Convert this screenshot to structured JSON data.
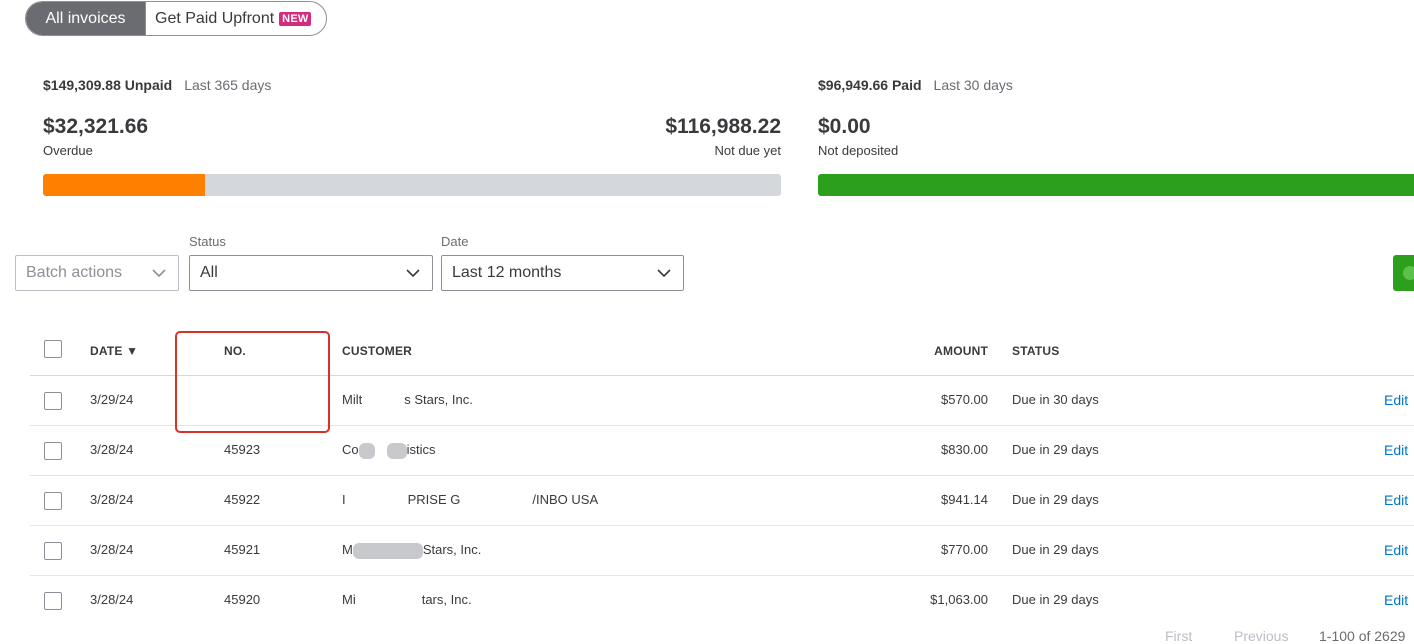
{
  "tabs": {
    "active": "All invoices",
    "inactive": "Get Paid Upfront",
    "badge": "NEW"
  },
  "summary": {
    "unpaid_amount": "$149,309.88 Unpaid",
    "unpaid_period": "Last 365 days",
    "overdue_value": "$32,321.66",
    "overdue_label": "Overdue",
    "notdue_value": "$116,988.22",
    "notdue_label": "Not due yet",
    "overdue_fraction": 0.22,
    "paid_amount": "$96,949.66 Paid",
    "paid_period": "Last 30 days",
    "notdeposited_value": "$0.00",
    "notdeposited_label": "Not deposited",
    "colors": {
      "overdue": "#ff8000",
      "paid": "#2ca01c",
      "track": "#d4d7dc"
    }
  },
  "filters": {
    "batch_label": "Batch actions",
    "status_label": "Status",
    "status_value": "All",
    "date_label": "Date",
    "date_value": "Last 12 months"
  },
  "table": {
    "headers": {
      "date": "DATE ▼",
      "no": "NO.",
      "customer": "CUSTOMER",
      "amount": "AMOUNT",
      "status": "STATUS"
    },
    "rows": [
      {
        "date": "3/29/24",
        "no": "",
        "cust_a": "Milt",
        "cust_b": "s Stars, Inc.",
        "cust_c": "",
        "amount": "$570.00",
        "status": "Due in 30 days",
        "action": "Edit"
      },
      {
        "date": "3/28/24",
        "no": "45923",
        "cust_a": "Co",
        "cust_b": "istics",
        "cust_c": "",
        "amount": "$830.00",
        "status": "Due in 29 days",
        "action": "Edit"
      },
      {
        "date": "3/28/24",
        "no": "45922",
        "cust_a": "I",
        "cust_b": "PRISE G",
        "cust_c": "/INBO USA",
        "amount": "$941.14",
        "status": "Due in 29 days",
        "action": "Edit"
      },
      {
        "date": "3/28/24",
        "no": "45921",
        "cust_a": "M",
        "cust_b": "Stars, Inc.",
        "cust_c": "",
        "amount": "$770.00",
        "status": "Due in 29 days",
        "action": "Edit"
      },
      {
        "date": "3/28/24",
        "no": "45920",
        "cust_a": "Mi",
        "cust_b": "tars, Inc.",
        "cust_c": "",
        "amount": "$1,063.00",
        "status": "Due in 29 days",
        "action": "Edit"
      }
    ]
  },
  "pagination": {
    "first": "First",
    "previous": "Previous",
    "range": "1-100 of 2629"
  }
}
